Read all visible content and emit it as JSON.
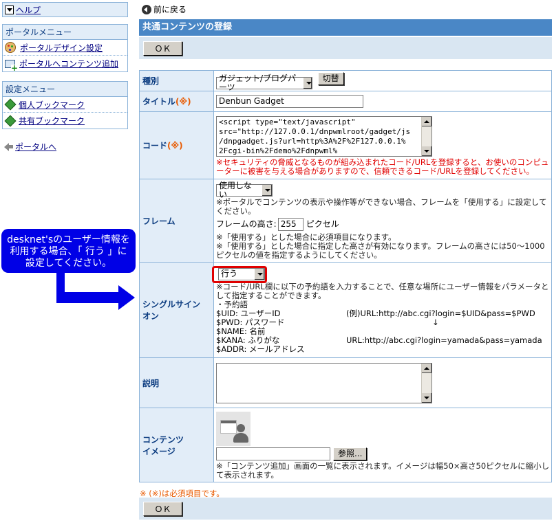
{
  "sidebar": {
    "help": "ヘルプ",
    "portal_menu": {
      "title": "ポータルメニュー",
      "items": [
        {
          "label": "ポータルデザイン設定",
          "icon": "palette-icon"
        },
        {
          "label": "ポータルへコンテンツ追加",
          "icon": "add-content-icon"
        }
      ]
    },
    "settings_menu": {
      "title": "設定メニュー",
      "items": [
        {
          "label": "個人ブックマーク",
          "icon": "bookmark-icon"
        },
        {
          "label": "共有ブックマーク",
          "icon": "bookmark-icon"
        }
      ]
    },
    "back_to_portal": "ポータルへ"
  },
  "callout": {
    "line1": "desknet'sのユーザー情報を",
    "line2": "利用する場合、「 行う 」に",
    "line3": "設定してください。"
  },
  "main": {
    "back_link": "前に戻る",
    "title": "共通コンテンツの登録",
    "ok_label": "ＯＫ",
    "required_mark": "(※)",
    "fields": {
      "type": {
        "label": "種別",
        "select_value": "ガジェット/ブログパーツ",
        "switch_button": "切替"
      },
      "title": {
        "label": "タイトル",
        "value": "Denbun Gadget"
      },
      "code": {
        "label": "コード",
        "value_lines": [
          "<script type=\"text/javascript\"",
          "src=\"http://127.0.0.1/dnpwmlroot/gadget/js",
          "/dnpgadget.js?url=http%3A%2F%2F127.0.0.1%",
          "2Fcgi-bin%2Fdemo%2Fdnpwml%"
        ],
        "warning": "※セキュリティの脅威となるものが組み込まれたコード/URLを登録すると、お使いのコンピューターに被害を与える場合がありますので、信頼できるコード/URLを登録してください。"
      },
      "frame": {
        "label": "フレーム",
        "select_value": "使用しない",
        "note1": "※ポータルでコンテンツの表示や操作等ができない場合、フレームを「使用する」に設定してください。",
        "height_label": "フレームの高さ:",
        "height_value": "255",
        "height_unit": "ピクセル",
        "note2": "※「使用する」とした場合に必須項目になります。",
        "note3": "※「使用する」とした場合に指定した高さが有効になります。フレームの高さには50～1000ピクセルの値を指定するようにしてください。"
      },
      "sso": {
        "label_line1": "シングルサイン",
        "label_line2": "オン",
        "select_value": "行う",
        "note": "※コード/URL欄に以下の予約語を入力することで、任意な場所にユーザー情報をパラメータとして指定することができます。",
        "reserved_header": "・予約語",
        "reserved": [
          "$UID: ユーザーID",
          "$PWD: パスワード",
          "$NAME: 名前",
          "$KANA: ふりがな",
          "$ADDR: メールアドレス"
        ],
        "example1": "(例)URL:http://abc.cgi?login=$UID&pass=$PWD",
        "example_arrow": "↓",
        "example2": "URL:http://abc.cgi?login=yamada&pass=yamada"
      },
      "description": {
        "label": "説明",
        "value": ""
      },
      "image": {
        "label_line1": "コンテンツ",
        "label_line2": "イメージ",
        "browse_button": "参照...",
        "note": "※「コンテンツ追加」画面の一覧に表示されます。イメージは幅50×高さ50ピクセルに縮小して表示されます。"
      }
    },
    "footnote": "※ (※)は必須項目です。"
  }
}
